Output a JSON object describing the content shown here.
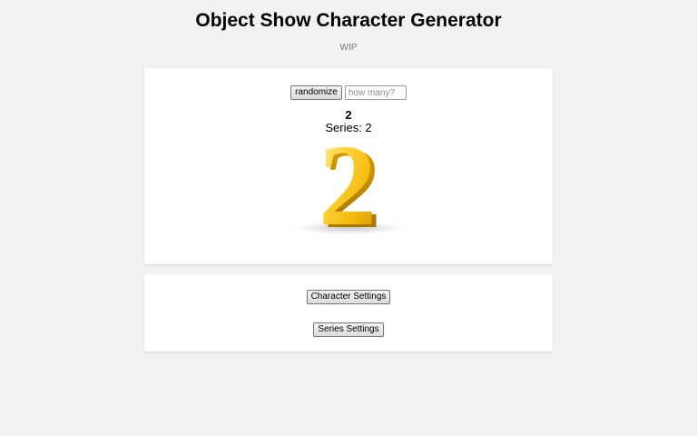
{
  "header": {
    "title": "Object Show Character Generator",
    "subtitle": "WIP"
  },
  "generator": {
    "randomize_label": "randomize",
    "count_placeholder": "how many?",
    "count_value": "",
    "character": {
      "name": "2",
      "series_label": "Series: 2",
      "image_icon": "golden-number-two-icon"
    }
  },
  "settings": {
    "character_settings_label": "Character Settings",
    "series_settings_label": "Series Settings"
  },
  "colors": {
    "background": "#f2f2f2",
    "card": "#ffffff",
    "gold_light": "#ffe066",
    "gold_dark": "#d9a300"
  }
}
